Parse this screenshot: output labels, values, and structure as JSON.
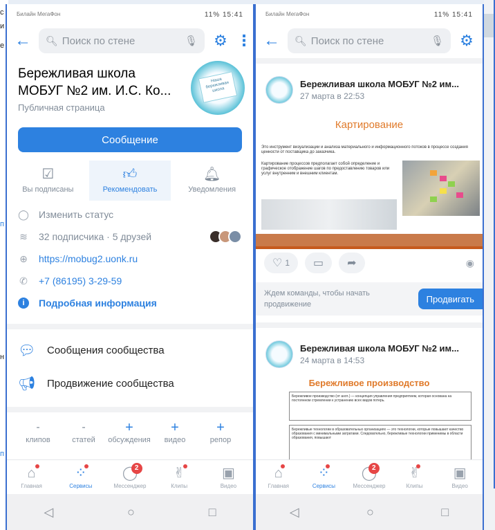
{
  "left_phone": {
    "status": {
      "carrier": "Билайн МегаФон",
      "right": "11%  15:41"
    },
    "search": {
      "placeholder": "Поиск по стене"
    },
    "profile": {
      "name": "Бережливая школа МОБУГ №2 им. И.С. Ко...",
      "type": "Публичная страница",
      "avatar_text": "Наша бережливая школа"
    },
    "message_button": "Сообщение",
    "actions": [
      {
        "label": "Вы подписаны",
        "icon": "check-square-icon"
      },
      {
        "label": "Рекомендовать",
        "icon": "thumbs-up-icon"
      },
      {
        "label": "Уведомления",
        "icon": "bell-icon"
      }
    ],
    "info": {
      "status": "Изменить статус",
      "subscribers": "32 подписчика · 5 друзей",
      "website": "https://mobug2.uonk.ru",
      "phone": "+7 (86195) 3-29-59",
      "details": "Подробная информация"
    },
    "menu": [
      {
        "label": "Сообщения сообщества",
        "icon": "chat-bubble-icon"
      },
      {
        "label": "Продвижение сообщества",
        "icon": "megaphone-icon"
      }
    ],
    "counters": [
      {
        "value": "-",
        "label": "клипов"
      },
      {
        "value": "-",
        "label": "статей"
      },
      {
        "value": "+",
        "label": "обсуждения"
      },
      {
        "value": "+",
        "label": "видео"
      },
      {
        "value": "+",
        "label": "репор"
      }
    ]
  },
  "tabbar": [
    {
      "label": "Главная",
      "icon": "home-icon"
    },
    {
      "label": "Сервисы",
      "icon": "services-icon"
    },
    {
      "label": "Мессенджер",
      "icon": "messenger-icon",
      "badge": "2"
    },
    {
      "label": "Клипы",
      "icon": "clips-icon"
    },
    {
      "label": "Видео",
      "icon": "video-icon"
    }
  ],
  "right_phone": {
    "status": {
      "carrier": "Билайн МегаФон",
      "right": "11%  15:41"
    },
    "search": {
      "placeholder": "Поиск по стене"
    },
    "post1": {
      "author": "Бережливая школа МОБУГ №2 им...",
      "date": "27 марта в 22:53",
      "image_title": "Картирование",
      "image_text1": "Это инструмент визуализации и анализа материального и информационного потоков в процессе создания ценности от поставщика до заказчика.",
      "image_text2": "Картирование процессов предполагает собой определение и графическое отображение шагов по предоставлению товаров или услуг внутренним и внешним клиентам.",
      "likes": "1"
    },
    "promo": {
      "text": "Ждем команды, чтобы начать продвижение",
      "button": "Продвигать"
    },
    "post2": {
      "author": "Бережливая школа МОБУГ №2 им...",
      "date": "24 марта в 14:53",
      "image_title": "Бережливое производство",
      "box1": "Бережливое производство (от англ.) — концепция управления предприятием, которая основана на постоянном стремлении к устранению всех видов потерь.",
      "box2": "Бережливые технологии в образовательных организациях — это технологии, которые повышают качество образования с минимальными затратами. Следовательно, бережливые технологии применимы в области образования, повышают"
    }
  }
}
